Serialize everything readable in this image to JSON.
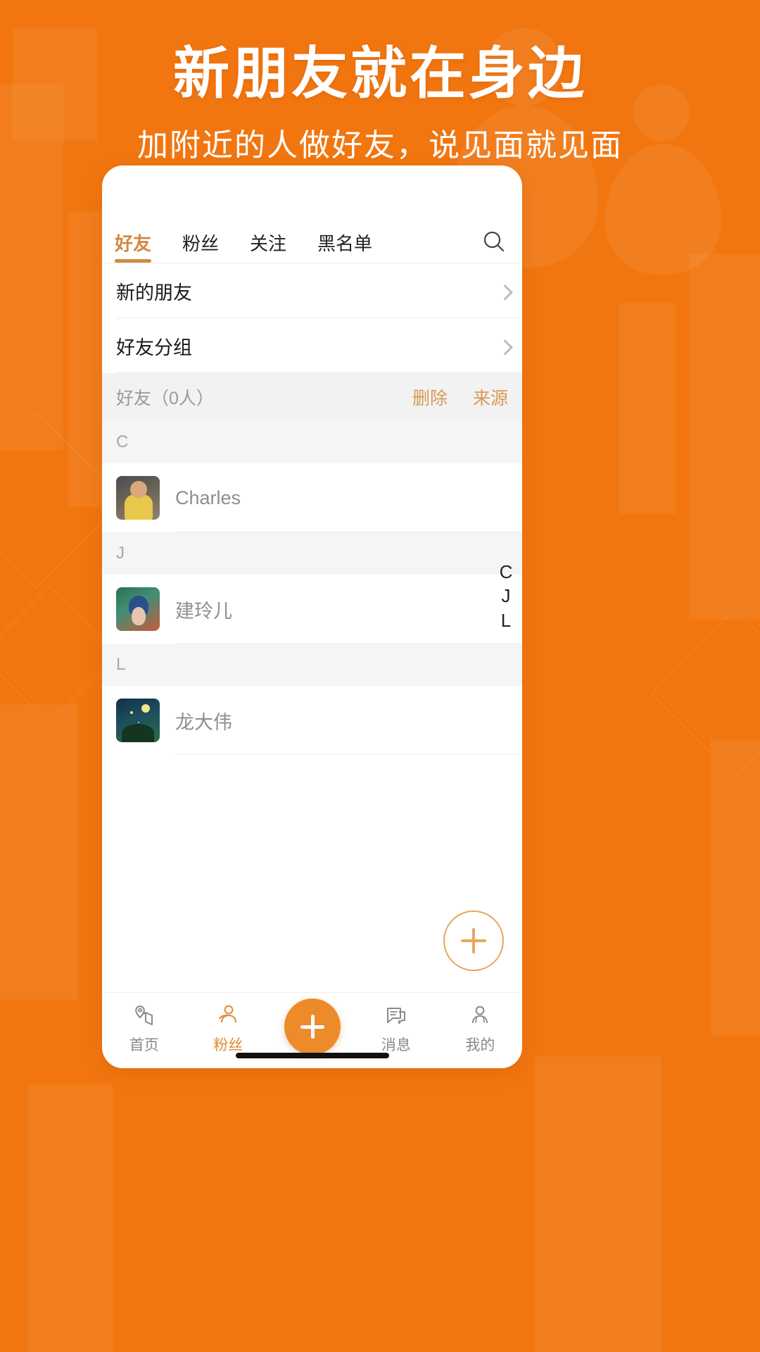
{
  "banner": {
    "title": "新朋友就在身边",
    "subtitle": "加附近的人做好友，说见面就见面",
    "background_color": "#F2760F"
  },
  "phone": {
    "tabs": [
      {
        "label": "好友",
        "active": true
      },
      {
        "label": "粉丝",
        "active": false
      },
      {
        "label": "关注",
        "active": false
      },
      {
        "label": "黑名单",
        "active": false
      }
    ],
    "search_icon": "search-icon",
    "accent_color": "#D08A40",
    "nav_rows": [
      {
        "label": "新的朋友",
        "chevron": "chevron-right-icon"
      },
      {
        "label": "好友分组",
        "chevron": "chevron-right-icon"
      }
    ],
    "section_header": {
      "title": "好友（0人）",
      "actions": [
        "删除",
        "来源"
      ]
    },
    "groups": [
      {
        "letter": "C",
        "contacts": [
          {
            "name": "Charles",
            "avatar": "avatar-charles"
          }
        ]
      },
      {
        "letter": "J",
        "contacts": [
          {
            "name": "建玲儿",
            "avatar": "avatar-jianlinger"
          }
        ]
      },
      {
        "letter": "L",
        "contacts": [
          {
            "name": "龙大伟",
            "avatar": "avatar-longdawei"
          }
        ]
      }
    ],
    "index_letters": [
      "C",
      "J",
      "L"
    ],
    "floating_add_button": {
      "icon": "plus-icon"
    },
    "tabbar": [
      {
        "label": "首页",
        "icon": "home-map-icon",
        "active": false
      },
      {
        "label": "粉丝",
        "icon": "fans-icon",
        "active": true
      },
      {
        "label": "消息",
        "icon": "message-icon",
        "active": false
      },
      {
        "label": "我的",
        "icon": "profile-icon",
        "active": false
      }
    ],
    "tabbar_center": {
      "icon": "plus-icon",
      "color": "#ED8B2B"
    }
  }
}
